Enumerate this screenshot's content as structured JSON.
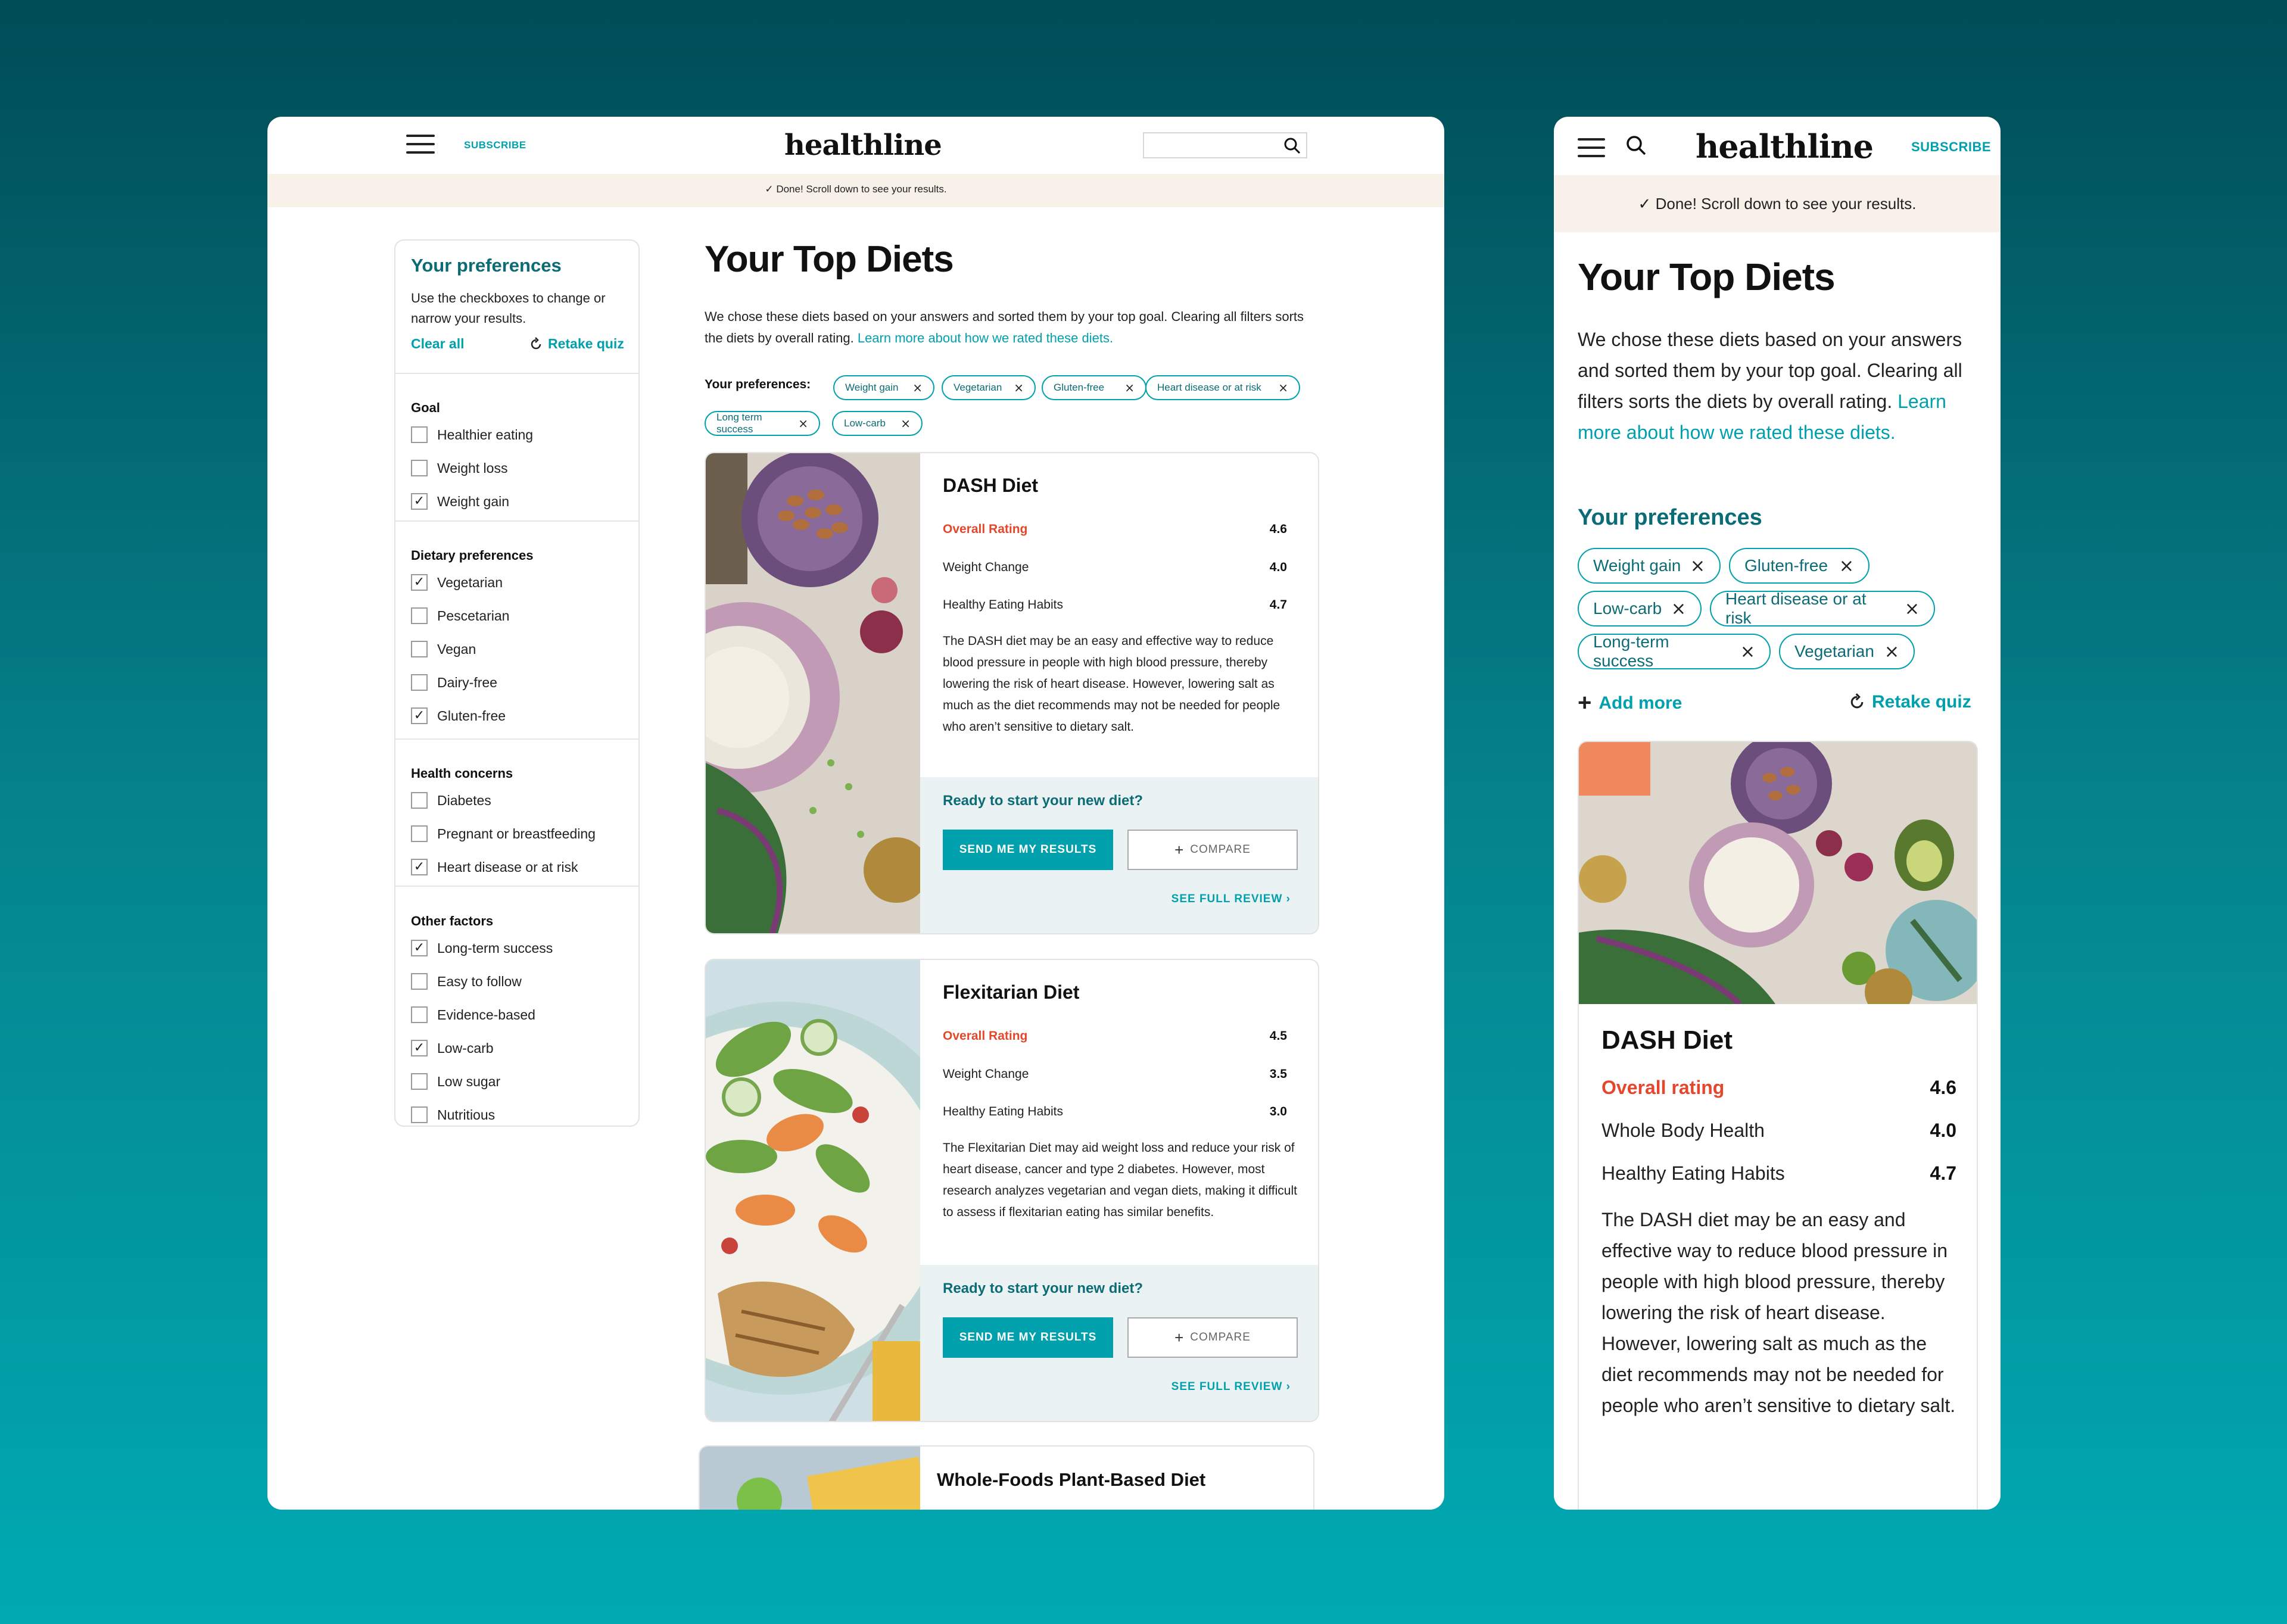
{
  "brand": {
    "logo": "healthline",
    "subscribe": "SUBSCRIBE"
  },
  "banner": {
    "check": "✓",
    "text": "Done! Scroll down to see your results."
  },
  "sidebar": {
    "title": "Your preferences",
    "description": "Use the checkboxes to change or narrow your results.",
    "clear_all": "Clear all",
    "retake_quiz": "Retake quiz",
    "groups": [
      {
        "heading": "Goal",
        "items": [
          {
            "label": "Healthier eating",
            "checked": false
          },
          {
            "label": "Weight loss",
            "checked": false
          },
          {
            "label": "Weight gain",
            "checked": true
          }
        ]
      },
      {
        "heading": "Dietary preferences",
        "items": [
          {
            "label": "Vegetarian",
            "checked": true
          },
          {
            "label": "Pescetarian",
            "checked": false
          },
          {
            "label": "Vegan",
            "checked": false
          },
          {
            "label": "Dairy-free",
            "checked": false
          },
          {
            "label": "Gluten-free",
            "checked": true
          }
        ]
      },
      {
        "heading": "Health concerns",
        "items": [
          {
            "label": "Diabetes",
            "checked": false
          },
          {
            "label": "Pregnant or breastfeeding",
            "checked": false
          },
          {
            "label": "Heart disease or at risk",
            "checked": true
          }
        ]
      },
      {
        "heading": "Other factors",
        "items": [
          {
            "label": "Long-term success",
            "checked": true
          },
          {
            "label": "Easy to follow",
            "checked": false
          },
          {
            "label": "Evidence-based",
            "checked": false
          },
          {
            "label": "Low-carb",
            "checked": true
          },
          {
            "label": "Low sugar",
            "checked": false
          },
          {
            "label": "Nutritious",
            "checked": false
          }
        ]
      }
    ]
  },
  "main": {
    "title": "Your Top Diets",
    "intro": "We chose these diets based on your answers and sorted them by your top goal. Clearing all filters sorts the diets by overall rating.",
    "intro_link": "Learn more about how we rated these diets.",
    "prefs_label": "Your preferences:",
    "pills": [
      "Weight gain",
      "Vegetarian",
      "Gluten-free",
      "Heart disease or at risk",
      "Long term success",
      "Low-carb"
    ],
    "cta_question": "Ready to start your new diet?",
    "send_label": "SEND ME MY RESULTS",
    "compare_label": "COMPARE",
    "compare_icon": "+",
    "review_label": "SEE FULL REVIEW",
    "review_icon": "›",
    "pill_close": "×",
    "diets": [
      {
        "name": "DASH Diet",
        "overall_label": "Overall Rating",
        "overall": "4.6",
        "r2_label": "Weight Change",
        "r2": "4.0",
        "r3_label": "Healthy Eating Habits",
        "r3": "4.7",
        "desc": "The DASH diet may be an easy and effective way to reduce blood pressure in people with high blood pressure, thereby lowering the risk of heart disease. However, lowering salt as much as the diet recommends may not be needed for people who aren’t sensitive to dietary salt."
      },
      {
        "name": "Flexitarian Diet",
        "overall_label": "Overall Rating",
        "overall": "4.5",
        "r2_label": "Weight Change",
        "r2": "3.5",
        "r3_label": "Healthy Eating Habits",
        "r3": "3.0",
        "desc": "The Flexitarian Diet may aid weight loss and reduce your risk of heart disease, cancer and type 2 diabetes. However, most research analyzes vegetarian and vegan diets, making it difficult to assess if flexitarian eating has similar benefits."
      },
      {
        "name": "Whole-Foods Plant-Based Diet"
      }
    ]
  },
  "mobile": {
    "title": "Your Top Diets",
    "intro": "We chose these diets based on your answers and sorted them by your top goal. Clearing all filters sorts the diets by overall rating.",
    "intro_link": "Learn more about how we rated these diets.",
    "prefs_title": "Your preferences",
    "pills": [
      "Weight gain",
      "Gluten-free",
      "Low-carb",
      "Heart disease or at risk",
      "Long-term success",
      "Vegetarian"
    ],
    "add_more": "Add more",
    "retake_quiz": "Retake quiz",
    "diet": {
      "name": "DASH Diet",
      "overall_label": "Overall rating",
      "overall": "4.6",
      "r2_label": "Whole Body Health",
      "r2": "4.0",
      "r3_label": "Healthy Eating Habits",
      "r3": "4.7",
      "desc": "The DASH diet may be an easy and effective way to reduce blood pressure in people with high blood pressure, thereby lowering the risk of heart disease. However, lowering salt as much as the diet recommends may not be needed for people who aren’t sensitive to dietary salt."
    }
  },
  "colors": {
    "teal": "#00a0ad",
    "dark_teal": "#0c6c76",
    "rating_red": "#e4472c",
    "banner": "#f8f1ea",
    "cta_bg": "#eaf2f3"
  }
}
